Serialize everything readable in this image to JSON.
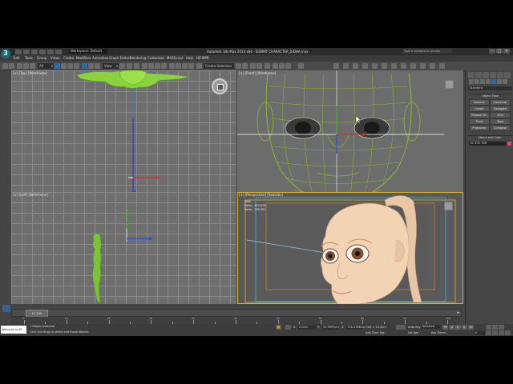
{
  "app": {
    "logo_text": "3",
    "workspace": "Workspace: Default",
    "window_title": "Autodesk 3ds Max 2014 x64  -  SUBMIT CHARACTER_JUDHA.max",
    "search_placeholder": "Type a keyword or phrase",
    "window_controls": [
      "–",
      "□",
      "×"
    ]
  },
  "menu": [
    "Edit",
    "Tools",
    "Group",
    "Views",
    "Create",
    "Modifiers",
    "Animation",
    "Graph Editors",
    "Rendering",
    "Customize",
    "MAXScript",
    "Help",
    "HZ.MPR"
  ],
  "toolbar": {
    "selection_filter": "All",
    "reference_coord": "View",
    "named_selection": "Create Selection Se"
  },
  "viewports": {
    "top_label": "[+] [Top] [Wireframe]",
    "front_label": "[+] [Front] [Wireframe]",
    "left_label": "[+] [Left] [Wireframe]",
    "perspective_label": "[+] [Perspective] [Realistic]",
    "stats": {
      "header": "Total",
      "polys_label": "Polys:",
      "polys_value": "120,876",
      "verts_label": "Verts:",
      "verts_value": "138,302"
    }
  },
  "command_panel": {
    "dropdown": "Standard",
    "object_type_rollout": "Object Type",
    "buttons": [
      "Dummy",
      "Container",
      "Crowd",
      "Delegate",
      "Expose Tm",
      "Grid",
      "Point",
      "Tape",
      "Protractor",
      "Compass"
    ],
    "name_color_rollout": "Name and Color",
    "object_name": "EC EYE TAR",
    "collapse_symbol": "-"
  },
  "timeline": {
    "frame_display": "0 / 100",
    "ticks": [
      "0",
      "10",
      "20",
      "30",
      "40",
      "50",
      "60",
      "70",
      "80",
      "90",
      "100"
    ]
  },
  "status": {
    "maxscript": "Welcome to M",
    "selection_info": "1 Helper Selected",
    "prompt": "Click and drag to select and move objects",
    "x_label": "X:",
    "x_value": "0.0cm",
    "y_label": "Y:",
    "y_value": "25.9993cm",
    "z_label": "Z:",
    "z_value": "178.4766cm",
    "grid": "Grid = 10.0cm",
    "add_time_tag": "Add Time Tag",
    "auto_key": "Auto Key",
    "set_key": "Set Key",
    "selected": "Selected",
    "key_filters": "Key Filters...",
    "frame": "0"
  }
}
